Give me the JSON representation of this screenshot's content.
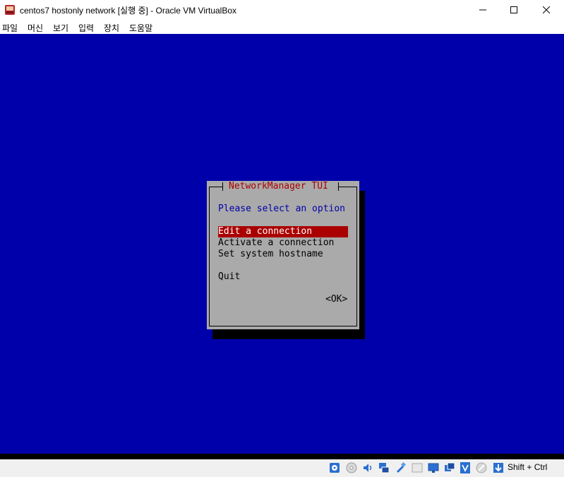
{
  "window": {
    "title": "centos7 hostonly network [실행 중] - Oracle VM VirtualBox",
    "icon": "virtualbox-icon"
  },
  "menu": {
    "items": [
      "파일",
      "머신",
      "보기",
      "입력",
      "장치",
      "도움말"
    ]
  },
  "tui": {
    "title": "NetworkManager TUI",
    "prompt": "Please select an option",
    "options": [
      "Edit a connection",
      "Activate a connection",
      "Set system hostname",
      "Quit"
    ],
    "selected_index": 0,
    "ok_label": "<OK>"
  },
  "statusbar": {
    "icons": [
      "hard-disk-icon",
      "optical-drive-icon",
      "audio-icon",
      "network-icon",
      "usb-icon",
      "shared-folders-icon",
      "display-icon",
      "recording-icon",
      "cpu-virtualization-icon",
      "mouse-integration-icon",
      "keyboard-capture-icon"
    ],
    "host_key": "Shift + Ctrl"
  },
  "colors": {
    "vm_background": "#0000aa",
    "dialog_background": "#aaaaaa",
    "title_red": "#aa0000",
    "selection": "#aa0000",
    "prompt_blue": "#0000aa"
  }
}
